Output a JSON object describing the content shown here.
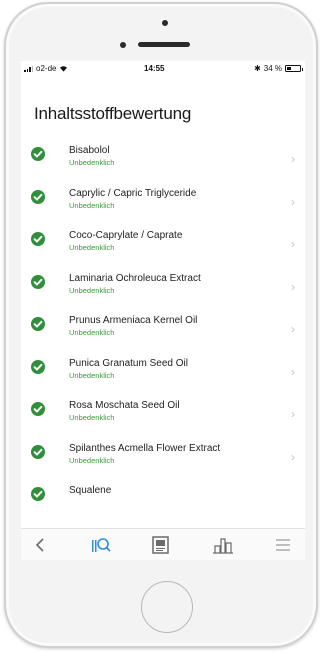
{
  "statusbar": {
    "carrier": "o2-de",
    "time": "14:55",
    "battery": "34 %"
  },
  "page": {
    "title": "Inhaltsstoffbewertung"
  },
  "ingredients": [
    {
      "name": "Bisabolol",
      "rating": "Unbedenklich"
    },
    {
      "name": "Caprylic / Capric Triglyceride",
      "rating": "Unbedenklich"
    },
    {
      "name": "Coco-Caprylate / Caprate",
      "rating": "Unbedenklich"
    },
    {
      "name": "Laminaria Ochroleuca Extract",
      "rating": "Unbedenklich"
    },
    {
      "name": "Prunus Armeniaca Kernel Oil",
      "rating": "Unbedenklich"
    },
    {
      "name": "Punica Granatum Seed Oil",
      "rating": "Unbedenklich"
    },
    {
      "name": "Rosa Moschata Seed Oil",
      "rating": "Unbedenklich"
    },
    {
      "name": "Spilanthes Acmella Flower Extract",
      "rating": "Unbedenklich"
    },
    {
      "name": "Squalene",
      "rating": ""
    }
  ],
  "tabbar": {
    "items": [
      "back-icon",
      "scan-icon",
      "document-icon",
      "compare-icon",
      "menu-icon"
    ],
    "active_color": "#2f8fd8",
    "inactive_color": "#8a8a8a"
  },
  "colors": {
    "check": "#2f8f3a",
    "rating": "#3a9a3a"
  }
}
